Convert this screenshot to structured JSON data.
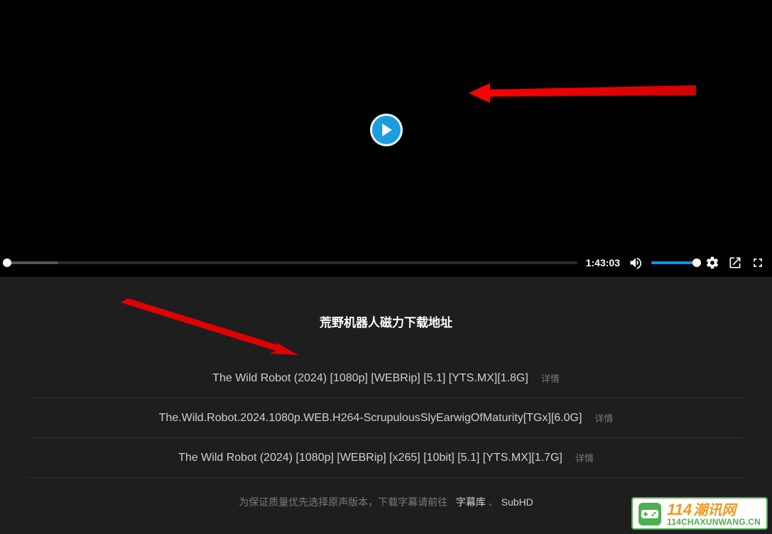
{
  "player": {
    "duration_label": "1:43:03",
    "accent": "#0096ff",
    "play_accent": "#1b9ee0"
  },
  "downloads": {
    "title": "荒野机器人磁力下载地址",
    "detail_label": "详情",
    "items": [
      {
        "name": "The Wild Robot (2024) [1080p] [WEBRip] [5.1] [YTS.MX][1.8G]"
      },
      {
        "name": "The.Wild.Robot.2024.1080p.WEB.H264-ScrupulousSlyEarwigOfMaturity[TGx][6.0G]"
      },
      {
        "name": "The Wild Robot (2024) [1080p] [WEBRip] [x265] [10bit] [5.1] [YTS.MX][1.7G]"
      }
    ],
    "note_prefix": "为保证质量优先选择原声版本，下载字幕请前往",
    "note_links": {
      "zimuku": "字幕库",
      "subhd": "SubHD"
    }
  },
  "watermark": {
    "num": "114",
    "cn": "潮讯网",
    "url": "114CHAXUNWANG.CN"
  }
}
